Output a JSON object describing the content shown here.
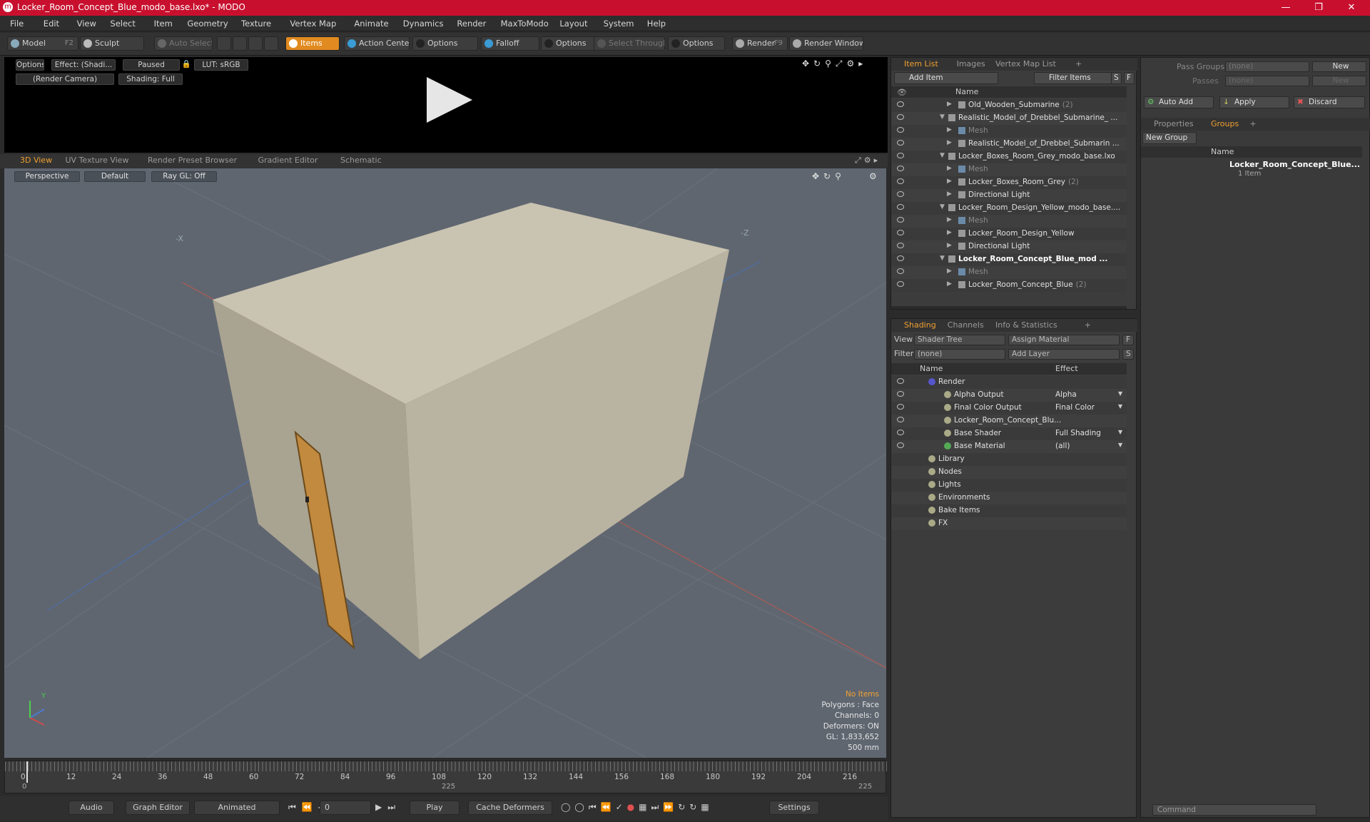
{
  "window": {
    "title": "Locker_Room_Concept_Blue_modo_base.lxo* - MODO",
    "app_icon": "modo-logo-icon"
  },
  "menu": [
    "File",
    "Edit",
    "View",
    "Select",
    "Item",
    "Geometry",
    "Texture",
    "Vertex Map",
    "Animate",
    "Dynamics",
    "Render",
    "MaxToModo",
    "Layout",
    "System",
    "Help"
  ],
  "toolbar": {
    "model": "Model",
    "model_key": "F2",
    "sculpt": "Sculpt",
    "auto_select": "Auto Select",
    "items": "Items",
    "action_center": "Action Center",
    "options1": "Options",
    "falloff": "Falloff",
    "options2": "Options",
    "select_through": "Select Through",
    "options3": "Options",
    "render": "Render",
    "render_key": "F9",
    "render_window": "Render Window"
  },
  "render_view": {
    "options": "Options",
    "effect": "Effect: (Shadi...",
    "paused": "Paused",
    "lut": "LUT: sRGB",
    "camera": "(Render Camera)",
    "shading": "Shading: Full"
  },
  "view_tabs": [
    "3D View",
    "UV Texture View",
    "Render Preset Browser",
    "Gradient Editor",
    "Schematic"
  ],
  "viewport": {
    "perspective": "Perspective",
    "default": "Default",
    "raygl": "Ray GL: Off",
    "info": [
      "No Items",
      "Polygons : Face",
      "Channels: 0",
      "Deformers: ON",
      "GL: 1,833,652",
      "500 mm"
    ],
    "axis_x": "-X",
    "axis_z": "-Z",
    "axis_y": "Y"
  },
  "timeline": {
    "ticks": [
      "0",
      "12",
      "24",
      "36",
      "48",
      "60",
      "72",
      "84",
      "96",
      "108",
      "120",
      "132",
      "144",
      "156",
      "168",
      "180",
      "192",
      "204",
      "216"
    ],
    "start": "0",
    "mid": "225",
    "end": "225"
  },
  "bottom": {
    "audio": "Audio",
    "graph_editor": "Graph Editor",
    "animated": "Animated",
    "frame": "0",
    "play": "Play",
    "cache": "Cache Deformers",
    "settings": "Settings"
  },
  "item_list": {
    "tabs": [
      "Item List",
      "Images",
      "Vertex Map List"
    ],
    "add_item": "Add Item",
    "filter_items": "Filter Items",
    "s": "S",
    "f": "F",
    "name_col": "Name",
    "rows": [
      {
        "label": "Old_Wooden_Submarine",
        "count": "(2)",
        "indent": 3,
        "style": ""
      },
      {
        "label": "Realistic_Model_of_Drebbel_Submarine_ ...",
        "count": "",
        "indent": 1,
        "style": ""
      },
      {
        "label": "Mesh",
        "count": "",
        "indent": 3,
        "style": "dim"
      },
      {
        "label": "Realistic_Model_of_Drebbel_Submarin ...",
        "count": "",
        "indent": 3,
        "style": ""
      },
      {
        "label": "Locker_Boxes_Room_Grey_modo_base.lxo",
        "count": "",
        "indent": 1,
        "style": ""
      },
      {
        "label": "Mesh",
        "count": "",
        "indent": 3,
        "style": "dim"
      },
      {
        "label": "Locker_Boxes_Room_Grey",
        "count": "(2)",
        "indent": 3,
        "style": ""
      },
      {
        "label": "Directional Light",
        "count": "",
        "indent": 3,
        "style": ""
      },
      {
        "label": "Locker_Room_Design_Yellow_modo_base....",
        "count": "",
        "indent": 1,
        "style": ""
      },
      {
        "label": "Mesh",
        "count": "",
        "indent": 3,
        "style": "dim"
      },
      {
        "label": "Locker_Room_Design_Yellow",
        "count": "",
        "indent": 3,
        "style": ""
      },
      {
        "label": "Directional Light",
        "count": "",
        "indent": 3,
        "style": ""
      },
      {
        "label": "Locker_Room_Concept_Blue_mod ...",
        "count": "",
        "indent": 1,
        "style": "bold"
      },
      {
        "label": "Mesh",
        "count": "",
        "indent": 3,
        "style": "dim"
      },
      {
        "label": "Locker_Room_Concept_Blue",
        "count": "(2)",
        "indent": 3,
        "style": ""
      }
    ]
  },
  "shading": {
    "tabs": [
      "Shading",
      "Channels",
      "Info & Statistics"
    ],
    "view_label": "View",
    "view_value": "Shader Tree",
    "assign": "Assign Material",
    "f": "F",
    "filter_label": "Filter",
    "filter_value": "(none)",
    "add_layer": "Add Layer",
    "s": "S",
    "name_col": "Name",
    "effect_col": "Effect",
    "rows": [
      {
        "label": "Render",
        "effect": "",
        "indent": 1
      },
      {
        "label": "Alpha Output",
        "effect": "Alpha",
        "indent": 2
      },
      {
        "label": "Final Color Output",
        "effect": "Final Color",
        "indent": 2
      },
      {
        "label": "Locker_Room_Concept_Blu...",
        "effect": "",
        "indent": 2
      },
      {
        "label": "Base Shader",
        "effect": "Full Shading",
        "indent": 2
      },
      {
        "label": "Base Material",
        "effect": "(all)",
        "indent": 2
      },
      {
        "label": "Library",
        "effect": "",
        "indent": 1
      },
      {
        "label": "Nodes",
        "effect": "",
        "indent": 1
      },
      {
        "label": "Lights",
        "effect": "",
        "indent": 1
      },
      {
        "label": "Environments",
        "effect": "",
        "indent": 1
      },
      {
        "label": "Bake Items",
        "effect": "",
        "indent": 1
      },
      {
        "label": "FX",
        "effect": "",
        "indent": 1
      }
    ]
  },
  "groups": {
    "pass_groups": "Pass Groups",
    "pass_value": "(none)",
    "new": "New",
    "passes": "Passes",
    "passes_value": "(none)",
    "new2": "New",
    "auto_add": "Auto Add",
    "apply": "Apply",
    "discard": "Discard",
    "tabs": [
      "Properties",
      "Groups"
    ],
    "new_group": "New Group",
    "name_col": "Name",
    "item_name": "Locker_Room_Concept_Blue...",
    "item_count": "1 Item"
  },
  "command": {
    "placeholder": "Command"
  },
  "colors": {
    "accent": "#f0a030",
    "titlebar": "#c8102e"
  }
}
